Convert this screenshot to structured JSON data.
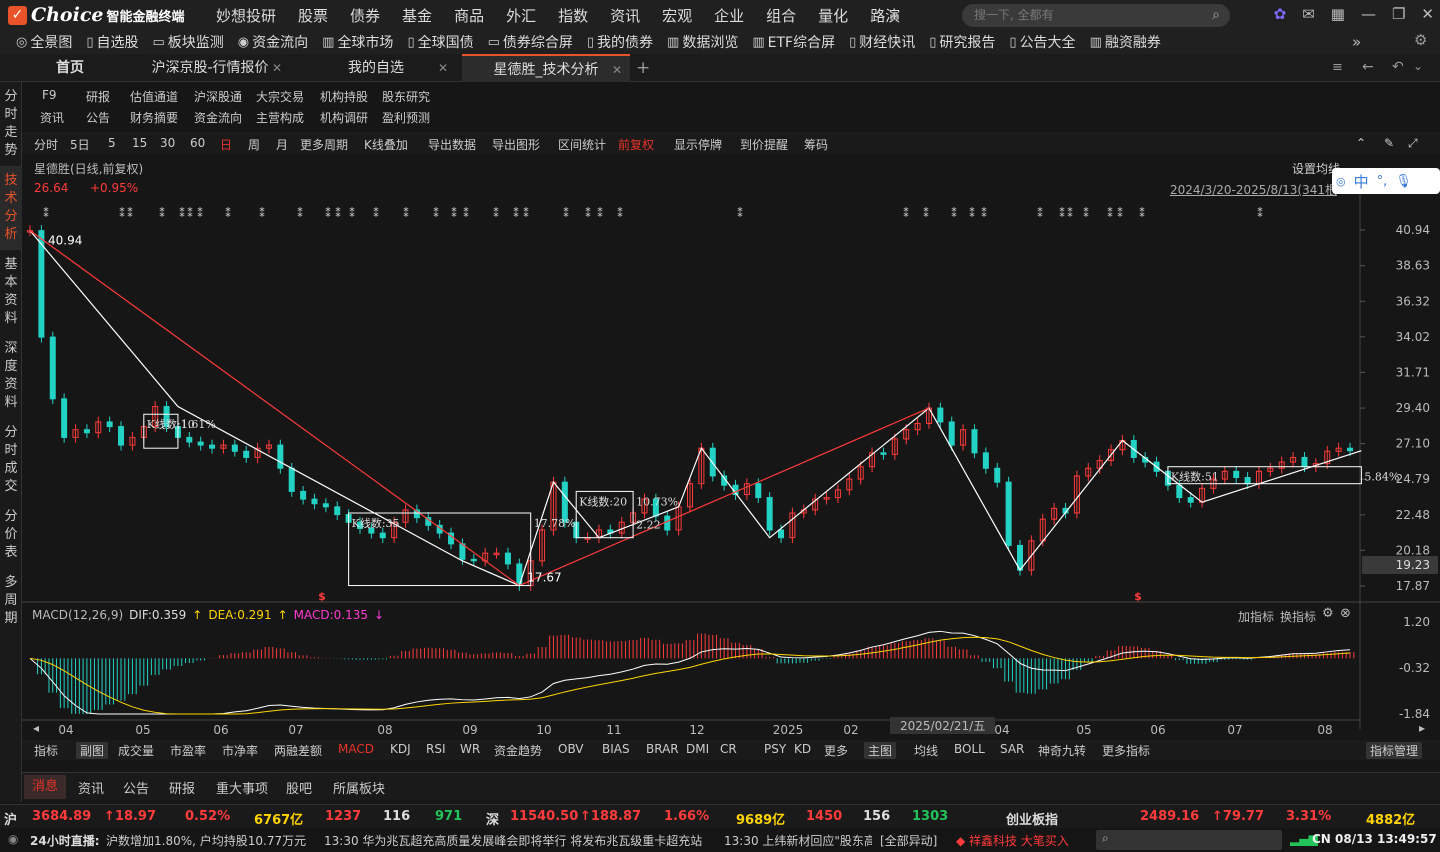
{
  "app": {
    "brand": "Choice",
    "subtitle": "智能金融终端"
  },
  "menu": [
    "妙想投研",
    "股票",
    "债券",
    "基金",
    "商品",
    "外汇",
    "指数",
    "资讯",
    "宏观",
    "企业",
    "组合",
    "量化",
    "路演"
  ],
  "search": {
    "placeholder": "搜一下, 全都有"
  },
  "toolbar": [
    {
      "icon": "globe-icon",
      "label": "全景图"
    },
    {
      "icon": "doc-icon",
      "label": "自选股"
    },
    {
      "icon": "monitor-icon",
      "label": "板块监测"
    },
    {
      "icon": "coin-icon",
      "label": "资金流向"
    },
    {
      "icon": "bar-icon",
      "label": "全球市场"
    },
    {
      "icon": "doc-icon",
      "label": "全球国债"
    },
    {
      "icon": "monitor-icon",
      "label": "债券综合屏"
    },
    {
      "icon": "doc-icon",
      "label": "我的债券"
    },
    {
      "icon": "bar-icon",
      "label": "数据浏览"
    },
    {
      "icon": "bar-icon",
      "label": "ETF综合屏"
    },
    {
      "icon": "doc-icon",
      "label": "财经快讯"
    },
    {
      "icon": "doc-icon",
      "label": "研究报告"
    },
    {
      "icon": "doc-icon",
      "label": "公告大全"
    },
    {
      "icon": "bar-icon",
      "label": "融资融券"
    }
  ],
  "tabs": [
    "首页",
    "沪深京股-行情报价",
    "我的自选",
    "星德胜_技术分析"
  ],
  "leftnav": [
    "分时走势",
    "技术分析",
    "基本资料",
    "深度资料",
    "分时成交",
    "分价表",
    "多周期"
  ],
  "quicklinks": [
    [
      "F9",
      "研报",
      "估值通道",
      "沪深股通",
      "大宗交易",
      "机构持股",
      "股东研究"
    ],
    [
      "资讯",
      "公告",
      "财务摘要",
      "资金流向",
      "主营构成",
      "机构调研",
      "盈利预测"
    ]
  ],
  "chartbar": [
    "分时",
    "5日",
    "5",
    "15",
    "30",
    "60",
    "日",
    "周",
    "月",
    "更多周期",
    "K线叠加",
    "导出数据",
    "导出图形",
    "区间统计",
    "前复权",
    "显示停牌",
    "到价提醒",
    "筹码"
  ],
  "stock": {
    "title": "星德胜(日线,前复权)",
    "price": "26.64",
    "change": "+0.95%",
    "range": "2024/3/20-2025/8/13(341根",
    "setting": "设置均线",
    "ime": "中"
  },
  "annotations": {
    "high": "40.94",
    "low": "17.67",
    "bx1": "K线数:10",
    "bx1p": "1.61%",
    "bx2": "K线数:35",
    "bx2p": "17.78%",
    "bx3": "K线数:20",
    "bx3p": "10.73%",
    "bx3v": "2.22",
    "bx4": "K线数:51",
    "bx4p": "5.84%"
  },
  "chart_data": {
    "type": "candlestick",
    "title": "星德胜(日线,前复权)",
    "price_axis": [
      "40.94",
      "38.63",
      "36.32",
      "34.02",
      "31.71",
      "29.40",
      "27.10",
      "24.79",
      "22.48",
      "20.18",
      "17.87"
    ],
    "current_price_label": "19.23",
    "ylim": [
      17.87,
      40.94
    ],
    "x_labels": [
      "04",
      "05",
      "06",
      "07",
      "08",
      "09",
      "10",
      "11",
      "12",
      "2025",
      "02",
      "04",
      "05",
      "06",
      "07",
      "08"
    ],
    "hover_date": "2025/02/21/五",
    "closes": [
      40.9,
      34.0,
      30.0,
      27.5,
      28.0,
      27.8,
      28.5,
      28.2,
      27.0,
      27.5,
      28.2,
      29.5,
      28.2,
      27.5,
      27.2,
      27.0,
      26.8,
      27.0,
      26.6,
      26.2,
      26.8,
      27.0,
      25.5,
      24.0,
      23.5,
      23.2,
      23.0,
      22.5,
      22.0,
      21.6,
      21.3,
      21.0,
      22.0,
      22.8,
      22.3,
      21.8,
      21.3,
      20.6,
      19.6,
      19.5,
      20.0,
      20.0,
      19.3,
      17.9,
      19.5,
      21.5,
      24.6,
      22.0,
      21.0,
      21.0,
      21.5,
      21.3,
      22.0,
      22.6,
      23.5,
      22.4,
      21.5,
      23.0,
      24.5,
      26.8,
      25.0,
      24.4,
      23.8,
      24.5,
      23.6,
      21.5,
      21.0,
      22.6,
      22.8,
      23.5,
      23.6,
      24.1,
      24.8,
      25.6,
      26.5,
      26.4,
      27.4,
      28.0,
      28.4,
      29.4,
      28.5,
      27.0,
      28.0,
      26.5,
      25.5,
      24.6,
      20.5,
      18.9,
      20.8,
      22.2,
      22.9,
      22.6,
      25.0,
      25.5,
      26.0,
      26.7,
      27.3,
      26.2,
      25.9,
      25.3,
      24.4,
      23.6,
      23.3,
      24.2,
      24.8,
      25.3,
      24.9,
      24.5,
      25.3,
      25.5,
      25.9,
      26.2,
      25.6,
      25.8,
      26.6,
      26.8,
      26.64
    ],
    "macd": {
      "dif": "DIF:0.359",
      "dea": "DEA:0.291",
      "hist": "MACD:0.135",
      "name": "MACD(12,26,9)",
      "axis": [
        "1.20",
        "-0.32",
        "-1.84"
      ]
    }
  },
  "macd_controls": [
    "加指标",
    "换指标"
  ],
  "indicators": [
    "指标",
    "副图",
    "成交量",
    "市盈率",
    "市净率",
    "两融差额",
    "MACD",
    "KDJ",
    "RSI",
    "WR",
    "资金趋势",
    "OBV",
    "BIAS",
    "BRAR",
    "DMI",
    "CR",
    "PSY",
    "KD",
    "更多",
    "主图",
    "均线",
    "BOLL",
    "SAR",
    "神奇九转",
    "更多指标",
    "指标管理"
  ],
  "newstabs": [
    "消息",
    "资讯",
    "公告",
    "研报",
    "重大事项",
    "股吧",
    "所属板块"
  ],
  "index": {
    "sh": {
      "name": "沪",
      "value": "3684.89",
      "chg": "↑18.97",
      "pct": "0.52%",
      "amt": "6767亿",
      "up": "1237",
      "flat": "116",
      "down": "971"
    },
    "sz": {
      "name": "深",
      "value": "11540.50",
      "chg": "↑188.87",
      "pct": "1.66%",
      "amt": "9689亿",
      "up": "1450",
      "flat": "156",
      "down": "1303"
    },
    "cy": {
      "name": "创业板指",
      "value": "2489.16",
      "chg": "↑79.77",
      "pct": "3.31%",
      "amt": "4882亿"
    }
  },
  "ticker": {
    "live": "24小时直播:",
    "news1": "沪数增加1.80%, 户均持股10.77万元",
    "news2": "13:30 华为兆瓦超充高质量发展峰会即将举行 将发布兆瓦级重卡超充站",
    "news3": "13:30 上纬新材回应\"股东高",
    "news4": "[全部异动]",
    "news5": "◆ 祥鑫科技 大笔买入",
    "status": "CN 08/13 13:49:57"
  }
}
